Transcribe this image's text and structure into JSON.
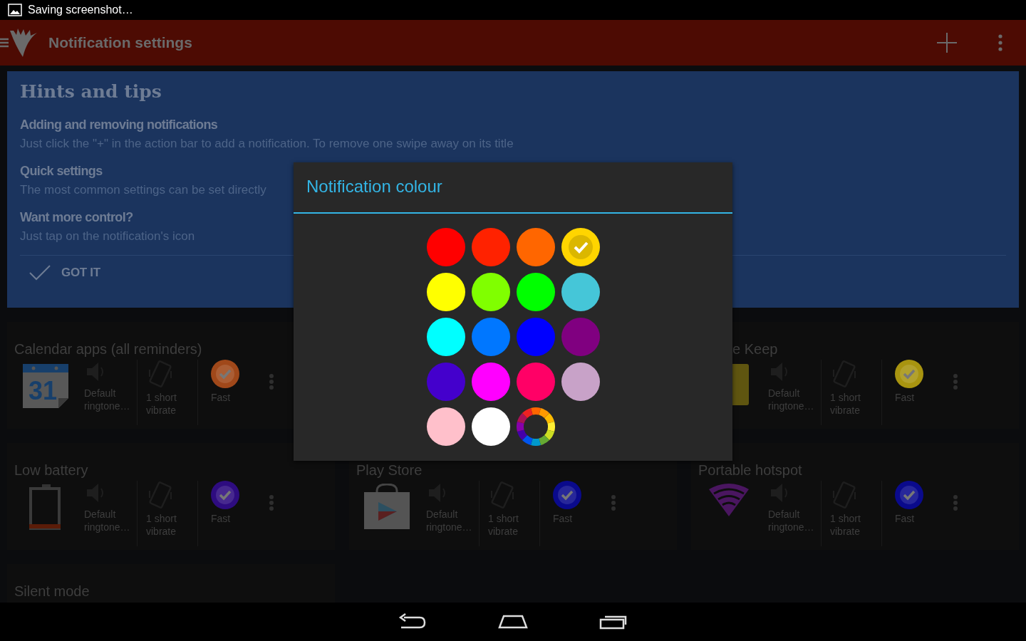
{
  "status_bar": {
    "text": "Saving screenshot…"
  },
  "action_bar": {
    "title": "Notification settings"
  },
  "hints": {
    "title": "Hints and tips",
    "tips": [
      {
        "heading": "Adding and removing notifications",
        "body": "Just click the \"+\" in the action bar to add a notification. To remove one swipe away on its title"
      },
      {
        "heading": "Quick settings",
        "body": "The most common settings can be set directly"
      },
      {
        "heading": "Want more control?",
        "body": "Just tap on the notification's icon"
      }
    ],
    "button": "GOT IT"
  },
  "cards": [
    {
      "title": "Calendar apps (all reminders)",
      "kind": "calendar",
      "icon_label": "31",
      "partial": false,
      "sound": "Default ringtone…",
      "vibrate": "1 short vibrate",
      "color": "#a0481a",
      "speed": "Fast"
    },
    {
      "title": "e Keep",
      "kind": "note",
      "partial": true,
      "sound": "Default ringtone…",
      "vibrate": "1 short vibrate",
      "color": "#a89410",
      "speed": "Fast"
    },
    {
      "title": "Low battery",
      "kind": "battery",
      "partial": false,
      "sound": "Default ringtone…",
      "vibrate": "1 short vibrate",
      "color": "#2e0c80",
      "speed": "Fast"
    },
    {
      "title": "Play Store",
      "kind": "bag",
      "partial": false,
      "sound": "Default ringtone…",
      "vibrate": "1 short vibrate",
      "color": "#0a0a8c",
      "speed": "Fast"
    },
    {
      "title": "Portable hotspot",
      "kind": "wifi",
      "partial": false,
      "sound": "Default ringtone…",
      "vibrate": "1 short vibrate",
      "color": "#0a0a8c",
      "speed": "Fast"
    },
    {
      "title": "Silent mode",
      "kind": "title_only",
      "partial": false
    }
  ],
  "dialog": {
    "title": "Notification colour",
    "swatches": [
      {
        "kind": "color",
        "color": "#ff0000",
        "selected": false
      },
      {
        "kind": "color",
        "color": "#ff2200",
        "selected": false
      },
      {
        "kind": "color",
        "color": "#ff6600",
        "selected": false
      },
      {
        "kind": "color",
        "color": "#ffd500",
        "selected": true
      },
      {
        "kind": "color",
        "color": "#ffff00",
        "selected": false
      },
      {
        "kind": "color",
        "color": "#80ff00",
        "selected": false
      },
      {
        "kind": "color",
        "color": "#00ff00",
        "selected": false
      },
      {
        "kind": "color",
        "color": "#45c6d8",
        "selected": false
      },
      {
        "kind": "color",
        "color": "#00ffff",
        "selected": false
      },
      {
        "kind": "color",
        "color": "#0077ff",
        "selected": false
      },
      {
        "kind": "color",
        "color": "#0000ff",
        "selected": false
      },
      {
        "kind": "color",
        "color": "#800080",
        "selected": false
      },
      {
        "kind": "color",
        "color": "#4400cc",
        "selected": false
      },
      {
        "kind": "color",
        "color": "#ff00ff",
        "selected": false
      },
      {
        "kind": "color",
        "color": "#ff0066",
        "selected": false
      },
      {
        "kind": "color",
        "color": "#c8a2c8",
        "selected": false
      },
      {
        "kind": "color",
        "color": "#ffc0cb",
        "selected": false
      },
      {
        "kind": "color",
        "color": "#ffffff",
        "selected": false
      },
      {
        "kind": "custom",
        "selected": false
      }
    ]
  }
}
